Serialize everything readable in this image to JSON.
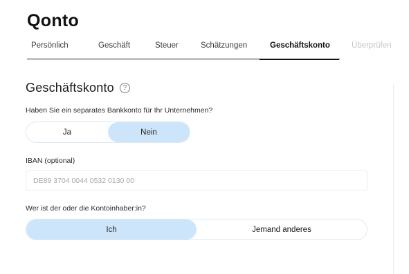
{
  "brand": {
    "logo": "Qonto"
  },
  "steps": [
    {
      "label": "Persönlich",
      "state": "default"
    },
    {
      "label": "Geschäft",
      "state": "default"
    },
    {
      "label": "Steuer",
      "state": "default"
    },
    {
      "label": "Schätzungen",
      "state": "default"
    },
    {
      "label": "Geschäftskonto",
      "state": "active"
    },
    {
      "label": "Überprüfen",
      "state": "disabled"
    }
  ],
  "section": {
    "title": "Geschäftskonto",
    "help_icon": "question-circle-icon"
  },
  "separate_account": {
    "question": "Haben Sie ein separates Bankkonto für Ihr Unternehmen?",
    "options": [
      "Ja",
      "Nein"
    ],
    "selected": "Nein"
  },
  "iban": {
    "label": "IBAN (optional)",
    "placeholder": "DE89 3704 0044 0532 0130 00",
    "value": ""
  },
  "account_holder": {
    "question": "Wer ist der oder die Kontoinhaber:in?",
    "options": [
      "Ich",
      "Jemand anderes"
    ],
    "selected": "Ich"
  },
  "colors": {
    "accent_selected": "#cde5fa",
    "toggle_border": "#dde8f3",
    "text": "#1d1d1d",
    "disabled": "#c2c2c2"
  }
}
